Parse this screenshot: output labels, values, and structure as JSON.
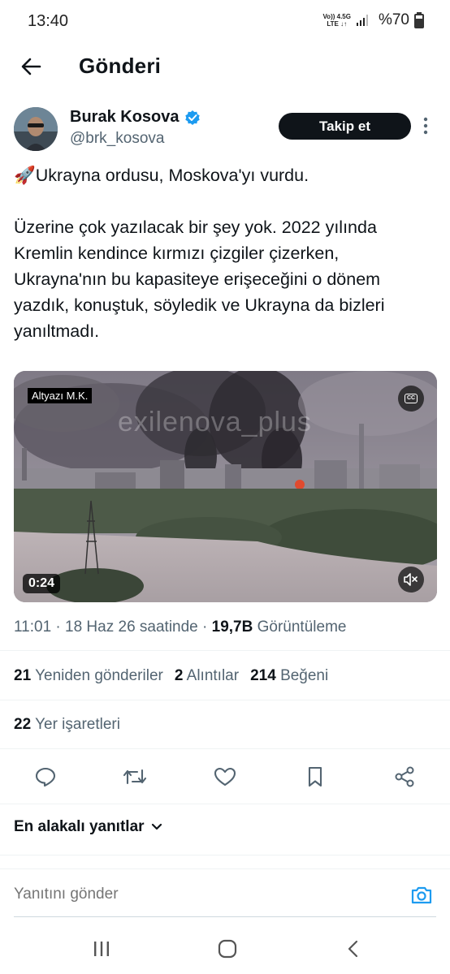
{
  "status_bar": {
    "time": "13:40",
    "network_top": "Vo)) 4.5G",
    "network_bottom": "LTE ↓↑",
    "battery": "%70"
  },
  "header": {
    "title": "Gönderi"
  },
  "author": {
    "name": "Burak Kosova",
    "handle": "@brk_kosova",
    "follow_label": "Takip et"
  },
  "tweet": {
    "line1": "🚀Ukrayna ordusu, Moskova'yı vurdu.",
    "paragraph2": "Üzerine çok yazılacak bir şey yok. 2022 yılında Kremlin kendince kırmızı çizgiler çizerken, Ukrayna'nın bu kapasiteye erişeceğini o dönem yazdık, konuştuk, söyledik ve Ukrayna da bizleri yanıltmadı."
  },
  "video": {
    "subtitle_badge": "Altyazı M.K.",
    "watermark": "exilenova_plus",
    "duration": "0:24",
    "cc_label": "CC"
  },
  "meta": {
    "time_date": "11:01 · 18 Haz 26 saatinde · ",
    "views_count": "19,7B",
    "views_label": " Görüntüleme"
  },
  "stats": {
    "retweets_count": "21",
    "retweets_label": "Yeniden gönderiler",
    "quotes_count": "2",
    "quotes_label": "Alıntılar",
    "likes_count": "214",
    "likes_label": "Beğeni",
    "bookmarks_count": "22",
    "bookmarks_label": "Yer işaretleri"
  },
  "actions": [
    "reply-icon",
    "retweet-icon",
    "like-icon",
    "bookmark-icon",
    "share-icon"
  ],
  "replies": {
    "sort_label": "En alakalı yanıtlar"
  },
  "reply_bar": {
    "placeholder": "Yanıtını gönder"
  },
  "colors": {
    "accent": "#1d9bf0",
    "text": "#0f1419",
    "secondary": "#536471",
    "follow_bg": "#0f1419"
  }
}
